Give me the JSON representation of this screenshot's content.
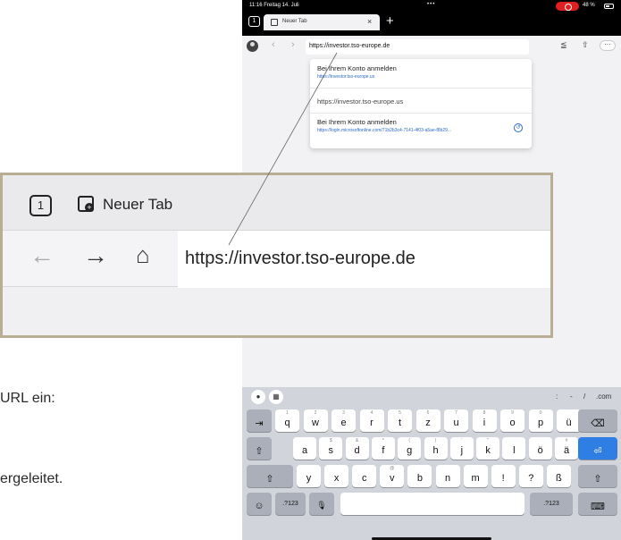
{
  "document": {
    "fragment_top": "URL ein:",
    "fragment_bottom": "ergeleitet."
  },
  "status_bar": {
    "time_date": "11:16  Freitag 14. Juli",
    "dots": "•••",
    "battery": "48 %"
  },
  "browser": {
    "tab_count": "1",
    "tab_title": "Neuer Tab",
    "tab_close": "×",
    "new_tab": "+",
    "back": "‹",
    "forward": "›",
    "url": "https://investor.tso-europe.de"
  },
  "suggestions": [
    {
      "title": "Bei Ihrem Konto anmelden",
      "url": "https://investor.tso-europe.us"
    },
    {
      "title": "https://investor.tso-europe.us",
      "url": ""
    },
    {
      "title": "Bei Ihrem Konto anmelden",
      "url": "https://login.microsoftonline.com/71b2b3c4-7141-4f03-a5ae-f8b29..."
    }
  ],
  "zoom_callout": {
    "tab_count": "1",
    "tab_title": "Neuer Tab",
    "back": "←",
    "forward": "→",
    "home": "⌂",
    "url": "https://investor.tso-europe.de"
  },
  "keyboard": {
    "top_right": [
      ":",
      "-",
      "/",
      ".com"
    ],
    "row1": [
      {
        "sub": "1",
        "main": "q"
      },
      {
        "sub": "2",
        "main": "w"
      },
      {
        "sub": "3",
        "main": "e"
      },
      {
        "sub": "4",
        "main": "r"
      },
      {
        "sub": "5",
        "main": "t"
      },
      {
        "sub": "6",
        "main": "z"
      },
      {
        "sub": "7",
        "main": "u"
      },
      {
        "sub": "8",
        "main": "i"
      },
      {
        "sub": "9",
        "main": "o"
      },
      {
        "sub": "0",
        "main": "p"
      },
      {
        "sub": "",
        "main": "ü"
      }
    ],
    "row2": [
      {
        "sub": "",
        "main": "a"
      },
      {
        "sub": "$",
        "main": "s"
      },
      {
        "sub": "&",
        "main": "d"
      },
      {
        "sub": "*",
        "main": "f"
      },
      {
        "sub": "(",
        "main": "g"
      },
      {
        "sub": ")",
        "main": "h"
      },
      {
        "sub": "'",
        "main": "j"
      },
      {
        "sub": "\"",
        "main": "k"
      },
      {
        "sub": "",
        "main": "l"
      },
      {
        "sub": "",
        "main": "ö"
      },
      {
        "sub": "#",
        "main": "ä"
      }
    ],
    "row3": [
      {
        "sub": "",
        "main": "y"
      },
      {
        "sub": "",
        "main": "x"
      },
      {
        "sub": "",
        "main": "c"
      },
      {
        "sub": "@",
        "main": "v"
      },
      {
        "sub": "",
        "main": "b"
      },
      {
        "sub": "",
        "main": "n"
      },
      {
        "sub": "",
        "main": "m"
      },
      {
        "sub": "",
        "main": "!"
      },
      {
        "sub": "",
        "main": "?"
      },
      {
        "sub": "",
        "main": "ß"
      }
    ],
    "numbers_label": ".?123",
    "tab_key": "⇥",
    "delete_key": "⌫",
    "return_key": "⏎",
    "shift_key": "⇧",
    "emoji_key": "☺",
    "mic_key": "🎙",
    "keyboard_key": "⌨"
  }
}
